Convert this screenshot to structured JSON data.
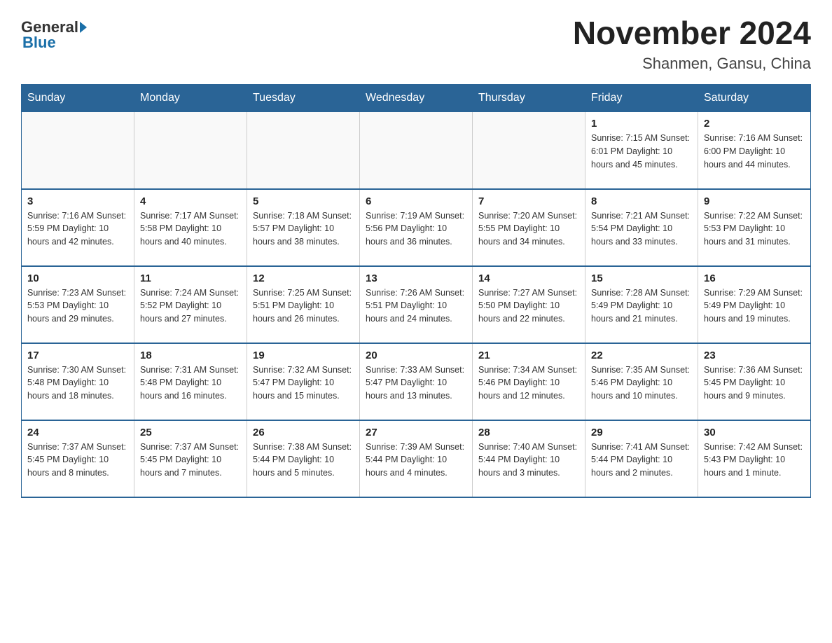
{
  "header": {
    "logo_general": "General",
    "logo_blue": "Blue",
    "title": "November 2024",
    "subtitle": "Shanmen, Gansu, China"
  },
  "days_of_week": [
    "Sunday",
    "Monday",
    "Tuesday",
    "Wednesday",
    "Thursday",
    "Friday",
    "Saturday"
  ],
  "weeks": [
    [
      {
        "day": "",
        "info": ""
      },
      {
        "day": "",
        "info": ""
      },
      {
        "day": "",
        "info": ""
      },
      {
        "day": "",
        "info": ""
      },
      {
        "day": "",
        "info": ""
      },
      {
        "day": "1",
        "info": "Sunrise: 7:15 AM\nSunset: 6:01 PM\nDaylight: 10 hours\nand 45 minutes."
      },
      {
        "day": "2",
        "info": "Sunrise: 7:16 AM\nSunset: 6:00 PM\nDaylight: 10 hours\nand 44 minutes."
      }
    ],
    [
      {
        "day": "3",
        "info": "Sunrise: 7:16 AM\nSunset: 5:59 PM\nDaylight: 10 hours\nand 42 minutes."
      },
      {
        "day": "4",
        "info": "Sunrise: 7:17 AM\nSunset: 5:58 PM\nDaylight: 10 hours\nand 40 minutes."
      },
      {
        "day": "5",
        "info": "Sunrise: 7:18 AM\nSunset: 5:57 PM\nDaylight: 10 hours\nand 38 minutes."
      },
      {
        "day": "6",
        "info": "Sunrise: 7:19 AM\nSunset: 5:56 PM\nDaylight: 10 hours\nand 36 minutes."
      },
      {
        "day": "7",
        "info": "Sunrise: 7:20 AM\nSunset: 5:55 PM\nDaylight: 10 hours\nand 34 minutes."
      },
      {
        "day": "8",
        "info": "Sunrise: 7:21 AM\nSunset: 5:54 PM\nDaylight: 10 hours\nand 33 minutes."
      },
      {
        "day": "9",
        "info": "Sunrise: 7:22 AM\nSunset: 5:53 PM\nDaylight: 10 hours\nand 31 minutes."
      }
    ],
    [
      {
        "day": "10",
        "info": "Sunrise: 7:23 AM\nSunset: 5:53 PM\nDaylight: 10 hours\nand 29 minutes."
      },
      {
        "day": "11",
        "info": "Sunrise: 7:24 AM\nSunset: 5:52 PM\nDaylight: 10 hours\nand 27 minutes."
      },
      {
        "day": "12",
        "info": "Sunrise: 7:25 AM\nSunset: 5:51 PM\nDaylight: 10 hours\nand 26 minutes."
      },
      {
        "day": "13",
        "info": "Sunrise: 7:26 AM\nSunset: 5:51 PM\nDaylight: 10 hours\nand 24 minutes."
      },
      {
        "day": "14",
        "info": "Sunrise: 7:27 AM\nSunset: 5:50 PM\nDaylight: 10 hours\nand 22 minutes."
      },
      {
        "day": "15",
        "info": "Sunrise: 7:28 AM\nSunset: 5:49 PM\nDaylight: 10 hours\nand 21 minutes."
      },
      {
        "day": "16",
        "info": "Sunrise: 7:29 AM\nSunset: 5:49 PM\nDaylight: 10 hours\nand 19 minutes."
      }
    ],
    [
      {
        "day": "17",
        "info": "Sunrise: 7:30 AM\nSunset: 5:48 PM\nDaylight: 10 hours\nand 18 minutes."
      },
      {
        "day": "18",
        "info": "Sunrise: 7:31 AM\nSunset: 5:48 PM\nDaylight: 10 hours\nand 16 minutes."
      },
      {
        "day": "19",
        "info": "Sunrise: 7:32 AM\nSunset: 5:47 PM\nDaylight: 10 hours\nand 15 minutes."
      },
      {
        "day": "20",
        "info": "Sunrise: 7:33 AM\nSunset: 5:47 PM\nDaylight: 10 hours\nand 13 minutes."
      },
      {
        "day": "21",
        "info": "Sunrise: 7:34 AM\nSunset: 5:46 PM\nDaylight: 10 hours\nand 12 minutes."
      },
      {
        "day": "22",
        "info": "Sunrise: 7:35 AM\nSunset: 5:46 PM\nDaylight: 10 hours\nand 10 minutes."
      },
      {
        "day": "23",
        "info": "Sunrise: 7:36 AM\nSunset: 5:45 PM\nDaylight: 10 hours\nand 9 minutes."
      }
    ],
    [
      {
        "day": "24",
        "info": "Sunrise: 7:37 AM\nSunset: 5:45 PM\nDaylight: 10 hours\nand 8 minutes."
      },
      {
        "day": "25",
        "info": "Sunrise: 7:37 AM\nSunset: 5:45 PM\nDaylight: 10 hours\nand 7 minutes."
      },
      {
        "day": "26",
        "info": "Sunrise: 7:38 AM\nSunset: 5:44 PM\nDaylight: 10 hours\nand 5 minutes."
      },
      {
        "day": "27",
        "info": "Sunrise: 7:39 AM\nSunset: 5:44 PM\nDaylight: 10 hours\nand 4 minutes."
      },
      {
        "day": "28",
        "info": "Sunrise: 7:40 AM\nSunset: 5:44 PM\nDaylight: 10 hours\nand 3 minutes."
      },
      {
        "day": "29",
        "info": "Sunrise: 7:41 AM\nSunset: 5:44 PM\nDaylight: 10 hours\nand 2 minutes."
      },
      {
        "day": "30",
        "info": "Sunrise: 7:42 AM\nSunset: 5:43 PM\nDaylight: 10 hours\nand 1 minute."
      }
    ]
  ]
}
